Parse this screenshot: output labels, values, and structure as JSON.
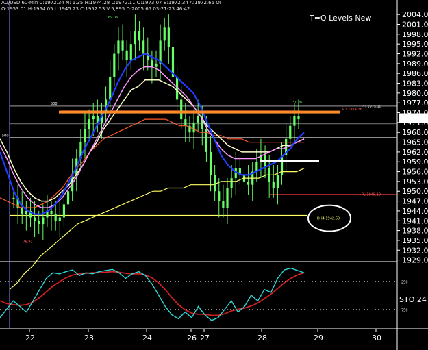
{
  "header": {
    "line1": "AU/USD 60-Min  C:1972.34  N:   1.35  H:1974.28  L:1972.11  O:1973.07  B:1972.34  A:1972.65  OI",
    "line2": "O:1953.01  H:1954.05  L:1945.23  C:1952.53  V:5,895  D:2005.65  03-21-23  46:42"
  },
  "title": "T=Q Levels New",
  "chart_data": {
    "type": "line",
    "x_labels": [
      "22",
      "23",
      "24",
      "26",
      "27",
      "28",
      "29",
      "30"
    ],
    "price_axis": {
      "ticks": [
        "2004.00",
        "2001.00",
        "1998.00",
        "1995.00",
        "1992.00",
        "1989.00",
        "1986.00",
        "1983.00",
        "1980.00",
        "1977.00",
        "1974.00",
        "1971.00",
        "1968.00",
        "1965.00",
        "1962.00",
        "1959.00",
        "1956.00",
        "1953.00",
        "1950.00",
        "1947.00",
        "1944.00",
        "1941.00",
        "1938.00",
        "1935.00",
        "1932.00",
        "1929.00"
      ],
      "ylim": [
        1928.5,
        2005.5
      ],
      "current": "1972.34"
    },
    "levels": [
      {
        "label": "R2  1974.36",
        "value": 1974.36,
        "color": "#ff3b3b"
      },
      {
        "label": "PH  1975.18",
        "value": 1975.18,
        "color": "#cccccc"
      },
      {
        "label": "PL  1949.10",
        "value": 1949.1,
        "color": "#ff3b3b"
      },
      {
        "label": "DH4  1942.60",
        "value": 1942.6,
        "color": "#ffff66"
      }
    ],
    "annotations": [
      "69.06",
      "31.26",
      "500",
      "500",
      "- 76.91"
    ],
    "sto_axis": {
      "label": "STO  24",
      "ticks": [
        "250",
        "750"
      ]
    },
    "series": {
      "close": [
        1948,
        1945,
        1943,
        1944,
        1942,
        1941,
        1940,
        1942,
        1944,
        1943,
        1941,
        1942,
        1946,
        1950,
        1955,
        1960,
        1965,
        1969,
        1972,
        1973,
        1971,
        1974,
        1978,
        1985,
        1992,
        1996,
        1993,
        1990,
        1995,
        1999,
        1996,
        1992,
        1990,
        1988,
        1989,
        1996,
        2000,
        1994,
        1985,
        1978,
        1972,
        1970,
        1968,
        1971,
        1973,
        1969,
        1962,
        1955,
        1950,
        1947,
        1945,
        1951,
        1954,
        1957,
        1955,
        1953,
        1952,
        1956,
        1959,
        1961,
        1957,
        1953,
        1951,
        1955,
        1961,
        1966,
        1970,
        1973,
        1972
      ],
      "ema_fast": [
        1962,
        1956,
        1950,
        1946,
        1944,
        1943,
        1943,
        1944,
        1946,
        1949,
        1953,
        1957,
        1962,
        1966,
        1970,
        1974,
        1978,
        1983,
        1987,
        1990,
        1991,
        1992,
        1991,
        1990,
        1988,
        1986,
        1984,
        1982,
        1980,
        1976,
        1971,
        1966,
        1961,
        1958,
        1956,
        1955,
        1955,
        1956,
        1957,
        1958,
        1959,
        1961,
        1963,
        1966,
        1968
      ],
      "ema_mid": [
        1964,
        1960,
        1955,
        1951,
        1948,
        1946,
        1945,
        1945,
        1946,
        1948,
        1951,
        1954,
        1958,
        1962,
        1966,
        1970,
        1974,
        1978,
        1982,
        1985,
        1987,
        1988,
        1988,
        1987,
        1985,
        1983,
        1981,
        1979,
        1976,
        1973,
        1969,
        1966,
        1963,
        1961,
        1960,
        1960,
        1960,
        1960,
        1961,
        1962,
        1963,
        1963,
        1964,
        1965,
        1966
      ],
      "ema_slow": [
        1966,
        1962,
        1957,
        1953,
        1950,
        1948,
        1947,
        1947,
        1948,
        1950,
        1952,
        1955,
        1958,
        1962,
        1965,
        1969,
        1972,
        1975,
        1978,
        1981,
        1982,
        1984,
        1984,
        1984,
        1983,
        1982,
        1980,
        1978,
        1976,
        1973,
        1970,
        1968,
        1966,
        1964,
        1963,
        1962,
        1962,
        1962,
        1962,
        1962,
        1963,
        1964,
        1964,
        1965,
        1966
      ],
      "ema_long": [
        1948,
        1947,
        1946,
        1945,
        1945,
        1945,
        1946,
        1947,
        1949,
        1951,
        1954,
        1957,
        1959,
        1962,
        1964,
        1966,
        1967,
        1968,
        1969,
        1970,
        1971,
        1972,
        1972,
        1972,
        1972,
        1971,
        1970,
        1970,
        1969,
        1968,
        1968,
        1967,
        1967,
        1966,
        1966,
        1966,
        1965,
        1965,
        1965,
        1965,
        1965,
        1965,
        1965,
        1965,
        1965
      ],
      "sma_slow": [
        1920,
        1922,
        1925,
        1927,
        1930,
        1932,
        1934,
        1936,
        1938,
        1940,
        1941,
        1942,
        1943,
        1944,
        1945,
        1946,
        1947,
        1948,
        1949,
        1950,
        1950,
        1951,
        1951,
        1951,
        1952,
        1952,
        1952,
        1952,
        1953,
        1953,
        1953,
        1954,
        1954,
        1954,
        1955,
        1955,
        1956,
        1956,
        1956,
        1957
      ],
      "sto_k": [
        10,
        25,
        40,
        30,
        20,
        40,
        60,
        80,
        90,
        88,
        92,
        95,
        85,
        90,
        88,
        92,
        94,
        96,
        90,
        80,
        88,
        92,
        85,
        70,
        50,
        30,
        15,
        8,
        20,
        10,
        30,
        15,
        5,
        10,
        25,
        40,
        20,
        30,
        50,
        40,
        60,
        55,
        80,
        95,
        98,
        94,
        90
      ],
      "sto_d": [
        40,
        35,
        33,
        32,
        33,
        38,
        46,
        56,
        66,
        74,
        81,
        86,
        88,
        89,
        90,
        90,
        91,
        92,
        91,
        89,
        88,
        88,
        86,
        81,
        72,
        60,
        46,
        33,
        24,
        18,
        16,
        16,
        14,
        14,
        17,
        22,
        25,
        27,
        31,
        36,
        44,
        52,
        62,
        72,
        80,
        86,
        90
      ]
    }
  },
  "markers": {
    "level_bubble_color": "#ffffff",
    "colors": {
      "candle": "#66ff66",
      "ema_fast": "#1f3cff",
      "ema_mid": "#ff99ff",
      "ema_slow": "#ffffcc",
      "ema_long": "#ff5a2a",
      "sma_slow": "#ffff66",
      "resistance_band": "#ff8c2a",
      "sto_k": "#2fd9d9",
      "sto_d": "#cc2222"
    }
  }
}
